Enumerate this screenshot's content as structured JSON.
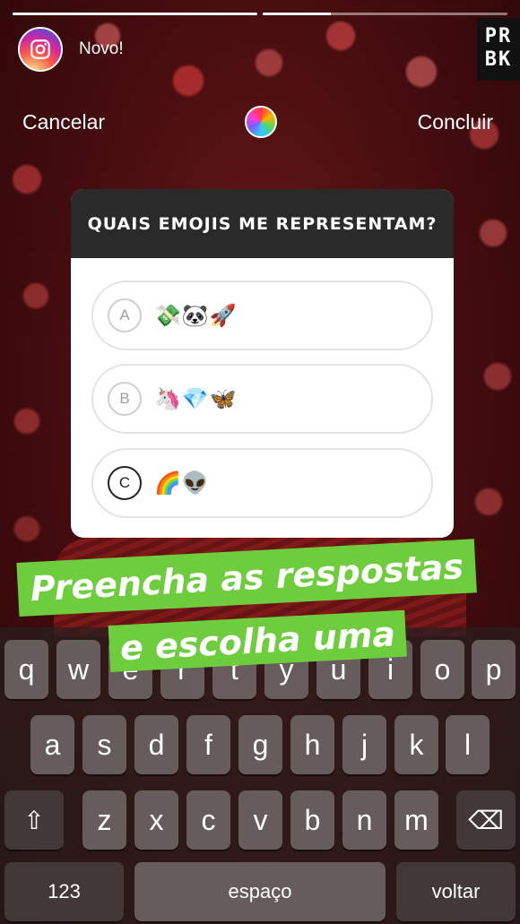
{
  "story": {
    "progress": [
      1.0,
      0.28
    ],
    "title": "Novo!",
    "watermark": "PR BK"
  },
  "topbar": {
    "cancel_label": "Cancelar",
    "done_label": "Concluir",
    "color_picker": "rainbow-circle-icon"
  },
  "quiz": {
    "question": "QUAIS EMOJIS ME REPRESENTAM?",
    "options": [
      {
        "letter": "A",
        "emojis": "💸🐼🚀",
        "selected": false
      },
      {
        "letter": "B",
        "emojis": "🦄💎🦋",
        "selected": false
      },
      {
        "letter": "C",
        "emojis": "🌈👽",
        "selected": true
      }
    ]
  },
  "caption": {
    "line1": "Preencha as respostas",
    "line2": "e escolha uma",
    "background": "#6ecd3c"
  },
  "keyboard": {
    "row1": [
      "q",
      "w",
      "e",
      "r",
      "t",
      "y",
      "u",
      "i",
      "o",
      "p"
    ],
    "row2": [
      "a",
      "s",
      "d",
      "f",
      "g",
      "h",
      "j",
      "k",
      "l"
    ],
    "row3": [
      "z",
      "x",
      "c",
      "v",
      "b",
      "n",
      "m"
    ],
    "shift": "⇧",
    "backspace": "⌫",
    "numbers": "123",
    "space": "espaço",
    "return": "voltar"
  }
}
